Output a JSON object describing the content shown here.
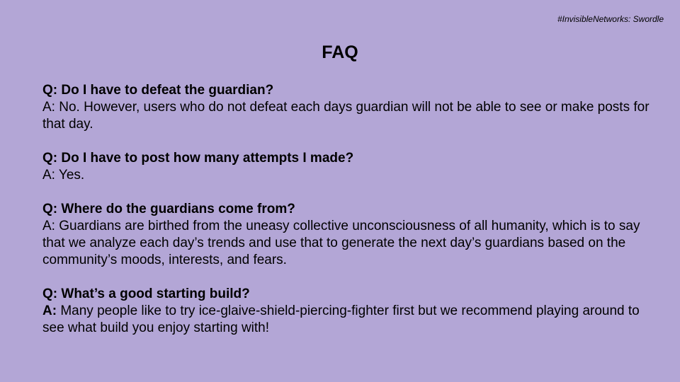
{
  "slide": {
    "tag": "#InvisibleNetworks: Swordle",
    "title": "FAQ"
  },
  "faq": {
    "items": [
      {
        "question": "Q: Do I have to defeat the guardian?",
        "answer": "A: No. However, users who do not defeat each days guardian will not be able to see or make posts for that day."
      },
      {
        "question": "Q: Do I have to post how many attempts I made?",
        "answer": "A: Yes."
      },
      {
        "question": "Q: Where do the guardians come from?",
        "answer": "A: Guardians are birthed from the uneasy collective unconsciousness of all humanity, which is to say that we analyze each day’s trends and use that to generate the next day’s guardians based on the community’s moods, interests, and fears."
      },
      {
        "question": "Q: What’s a good starting build?",
        "answer_prefix": "A:",
        "answer": " Many people like to try ice-glaive-shield-piercing-fighter first but we recommend playing around to see what build you enjoy starting with!"
      }
    ]
  },
  "colors": {
    "background": "#b3a6d6",
    "text": "#000000"
  }
}
